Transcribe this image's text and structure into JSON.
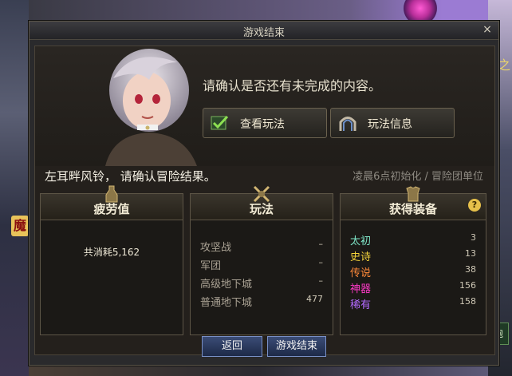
{
  "background": {
    "left_badge": "魔",
    "right_fragment": "击之",
    "right_box": "泡"
  },
  "dialog": {
    "title": "游戏结束",
    "close_glyph": "×",
    "message": "请确认是否还有未完成的内容。",
    "buttons": {
      "view_play": "查看玩法",
      "play_info": "玩法信息"
    },
    "warn_line": "左耳畔风铃， 请确认冒险结果。",
    "reset_note": "凌晨6点初始化 / 冒险团单位"
  },
  "panels": {
    "fatigue": {
      "title": "疲劳值",
      "text": "共消耗5,162"
    },
    "play": {
      "title": "玩法",
      "rows": [
        {
          "label": "攻坚战",
          "value": "–"
        },
        {
          "label": "军团",
          "value": "–"
        },
        {
          "label": "高级地下城",
          "value": "–"
        },
        {
          "label": "普通地下城",
          "value": "477"
        }
      ]
    },
    "equipment": {
      "title": "获得装备",
      "help": "?",
      "rows": [
        {
          "label": "太初",
          "value": "3",
          "color": "#7ee6c8"
        },
        {
          "label": "史诗",
          "value": "13",
          "color": "#f3d23a"
        },
        {
          "label": "传说",
          "value": "38",
          "color": "#ff8a3a"
        },
        {
          "label": "神器",
          "value": "156",
          "color": "#ff3ac8"
        },
        {
          "label": "稀有",
          "value": "158",
          "color": "#b46bff"
        }
      ]
    }
  },
  "footer": {
    "back": "返回",
    "end": "游戏结束"
  },
  "colors": {
    "accent_gold": "#e6c04a",
    "panel_border": "#5d5546",
    "button_blue": "#3b4c76"
  }
}
